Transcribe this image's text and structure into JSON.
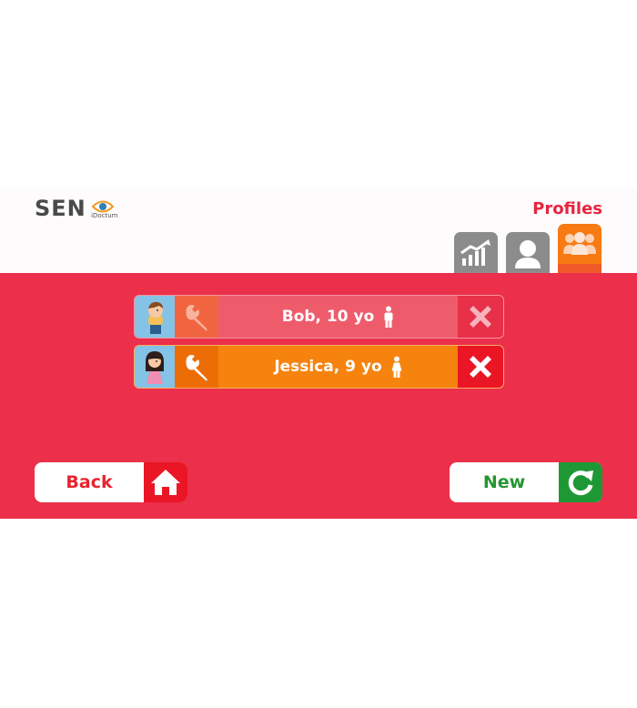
{
  "header": {
    "logo_text": "SEN",
    "logo_subtitle": "iDoctum",
    "title": "Profiles"
  },
  "tabs": [
    {
      "icon": "chart-icon",
      "active": false
    },
    {
      "icon": "user-icon",
      "active": false
    },
    {
      "icon": "group-icon",
      "active": true
    }
  ],
  "profiles": [
    {
      "label": "Bob, 10 yo",
      "gender": "boy",
      "avatar": "boy-avatar-icon"
    },
    {
      "label": "Jessica, 9 yo",
      "gender": "girl",
      "avatar": "girl-avatar-icon"
    }
  ],
  "buttons": {
    "back_label": "Back",
    "new_label": "New"
  },
  "colors": {
    "band": "#ec2f4a",
    "accent_orange": "#f77a13",
    "title_red": "#e8243f",
    "new_green": "#1e9834"
  }
}
